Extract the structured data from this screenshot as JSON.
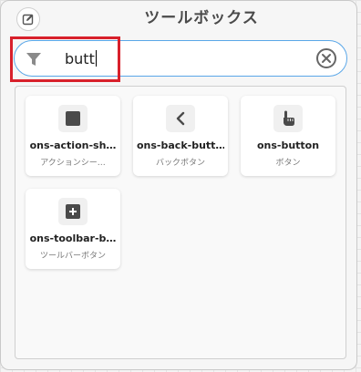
{
  "toolbox": {
    "title": "ツールボックス"
  },
  "search": {
    "value": "butt",
    "filter_icon": "filter-icon",
    "clear_icon": "clear-circle-icon"
  },
  "components": [
    {
      "name": "ons-action-sh…",
      "description": "アクションシー…",
      "icon": "square-icon"
    },
    {
      "name": "ons-back-butt…",
      "description": "バックボタン",
      "icon": "chevron-left-icon"
    },
    {
      "name": "ons-button",
      "description": "ボタン",
      "icon": "pointing-hand-icon"
    },
    {
      "name": "ons-toolbar-b…",
      "description": "ツールバーボタン",
      "icon": "plus-square-icon"
    }
  ],
  "colors": {
    "accent_border": "#5aa7e8",
    "highlight": "#d8202b",
    "icon": "#4a4a4a"
  }
}
